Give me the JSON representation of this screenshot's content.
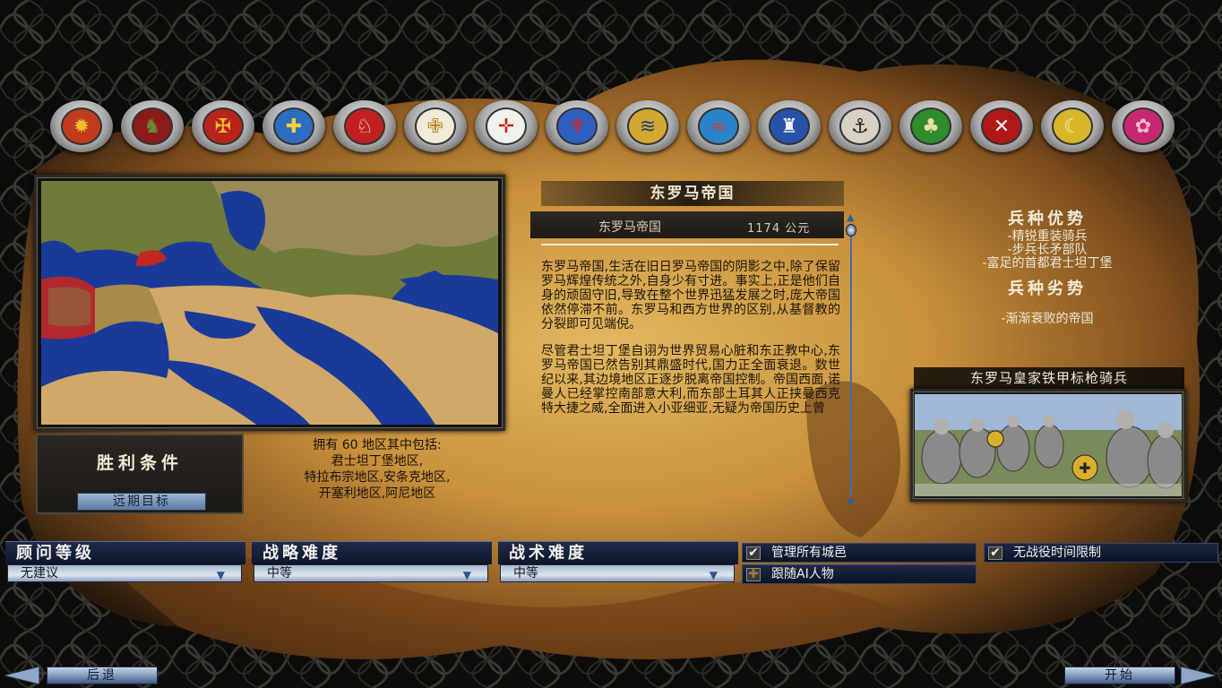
{
  "factions": [
    {
      "name": "sun-emblem",
      "bg": "#c23a1c",
      "fg": "#f2c02e",
      "glyph": "✹"
    },
    {
      "name": "red-lion-emblem",
      "bg": "#8c1a18",
      "fg": "#6a8a3a",
      "glyph": "♞"
    },
    {
      "name": "eagle-emblem",
      "bg": "#b8241c",
      "fg": "#f0c030",
      "glyph": "✠"
    },
    {
      "name": "cross-emblem",
      "bg": "#2d6cc0",
      "fg": "#f2d040",
      "glyph": "✚"
    },
    {
      "name": "lion-emblem",
      "bg": "#c02020",
      "fg": "#f3e8c8",
      "glyph": "♘"
    },
    {
      "name": "greek-cross-emblem",
      "bg": "#f0ead8",
      "fg": "#b8842a",
      "glyph": "✙"
    },
    {
      "name": "jerusalem-cross-emblem",
      "bg": "#f2f0ea",
      "fg": "#c01c1c",
      "glyph": "✛"
    },
    {
      "name": "wyvern-emblem",
      "bg": "#2f5fc0",
      "fg": "#d02818",
      "glyph": "♆"
    },
    {
      "name": "chevron-emblem",
      "bg": "#d2a830",
      "fg": "#243b78",
      "glyph": "≋"
    },
    {
      "name": "wave-emblem",
      "bg": "#2c84c8",
      "fg": "#e03a2a",
      "glyph": "≈"
    },
    {
      "name": "castle-emblem",
      "bg": "#2652a8",
      "fg": "#f2f2f2",
      "glyph": "♜"
    },
    {
      "name": "ship-emblem",
      "bg": "#d8d2c4",
      "fg": "#1a1a1a",
      "glyph": "⚓"
    },
    {
      "name": "tree-emblem",
      "bg": "#2f8c2a",
      "fg": "#e8e0a0",
      "glyph": "♣"
    },
    {
      "name": "crossed-swords-emblem",
      "bg": "#b01818",
      "fg": "#f2f2f2",
      "glyph": "✕"
    },
    {
      "name": "crescent-emblem",
      "bg": "#d8b62a",
      "fg": "#f6ecb0",
      "glyph": "☾"
    },
    {
      "name": "flower-emblem",
      "bg": "#c62870",
      "fg": "#f2b8cc",
      "glyph": "✿"
    }
  ],
  "victory": {
    "title": "胜利条件",
    "button": "远期目标",
    "lines": [
      "拥有 60 地区其中包括:",
      "君士坦丁堡地区,",
      "特拉布宗地区,安条克地区,",
      "开塞利地区,阿尼地区"
    ]
  },
  "description": {
    "title": "东罗马帝国",
    "faction": "东罗马帝国",
    "year": "1174 公元",
    "paragraphs": [
      "东罗马帝国,生活在旧日罗马帝国的阴影之中,除了保留罗马辉煌传统之外,自身少有寸进。事实上,正是他们自身的顽固守旧,导致在整个世界迅猛发展之时,庞大帝国依然停滞不前。东罗马和西方世界的区别,从基督教的分裂即可见端倪。",
      "尽管君士坦丁堡自诩为世界贸易心脏和东正教中心,东罗马帝国已然告别其鼎盛时代,国力正全面衰退。数世纪以来,其边境地区正逐步脱离帝国控制。帝国西面,诺曼人已经掌控南部意大利,而东部土耳其人正挟曼西克特大捷之威,全面进入小亚细亚,无疑为帝国历史上曾"
    ]
  },
  "strengths": {
    "title": "兵种优势",
    "items": [
      "-精锐重装骑兵",
      "-步兵长矛部队",
      "-富足的首都君士坦丁堡"
    ],
    "weak_title": "兵种劣势",
    "weak_items": [
      "-渐渐衰败的帝国"
    ]
  },
  "unit": {
    "title": "东罗马皇家铁甲标枪骑兵"
  },
  "settings": [
    {
      "label": "顾问等级",
      "value": "无建议"
    },
    {
      "label": "战略难度",
      "value": "中等"
    },
    {
      "label": "战术难度",
      "value": "中等"
    }
  ],
  "checks": {
    "manage_all": {
      "label": "管理所有城邑",
      "checked": true,
      "mark": "✔"
    },
    "follow_ai": {
      "label": "跟随AI人物",
      "checked": false,
      "mark": "✚"
    },
    "no_time_limit": {
      "label": "无战役时间限制",
      "checked": true,
      "mark": "✔"
    }
  },
  "nav": {
    "back": "后退",
    "start": "开始"
  }
}
